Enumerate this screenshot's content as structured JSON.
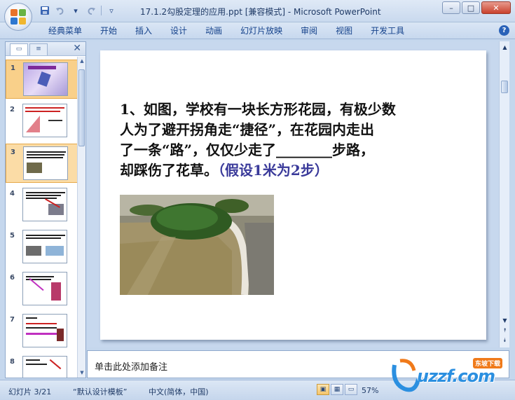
{
  "app": {
    "window_title": "17.1.2勾股定理的应用.ppt [兼容模式] - Microsoft PowerPoint"
  },
  "ribbon": {
    "tabs": [
      "经典菜单",
      "开始",
      "插入",
      "设计",
      "动画",
      "幻灯片放映",
      "审阅",
      "视图",
      "开发工具"
    ],
    "help_label": "?"
  },
  "window_controls": {
    "minimize": "–",
    "maximize": "□",
    "close": "✕"
  },
  "slide_pane": {
    "close_label": "✕",
    "thumbnails": [
      {
        "number": "1",
        "state": "selected"
      },
      {
        "number": "2",
        "state": "normal"
      },
      {
        "number": "3",
        "state": "current"
      },
      {
        "number": "4",
        "state": "normal"
      },
      {
        "number": "5",
        "state": "normal"
      },
      {
        "number": "6",
        "state": "normal"
      },
      {
        "number": "7",
        "state": "normal"
      },
      {
        "number": "8",
        "state": "normal"
      }
    ]
  },
  "slide": {
    "line1": "1、如图，学校有一块长方形花园，有极少数",
    "line2": "人为了避开拐角走“捷径”，在花园内走出",
    "line3": "了一条“路”，仅仅少走了________步路，",
    "line4_main": "却踩伤了花草。",
    "line4_hint": "（假设1米为2步）"
  },
  "notes": {
    "placeholder": "单击此处添加备注"
  },
  "status": {
    "slide_info": "幻灯片 3/21",
    "theme": "“默认设计模板”",
    "language": "中文(简体，中国)",
    "zoom": "57%"
  },
  "watermark": {
    "text": "uzzf.com",
    "badge": "东坡下载"
  },
  "colors": {
    "accent": "#15428b",
    "hint_text": "#3a3a9a",
    "selection": "#f9d08a"
  }
}
